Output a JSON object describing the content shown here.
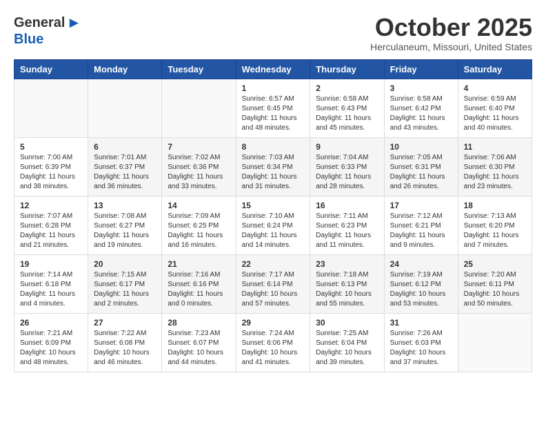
{
  "header": {
    "logo_general": "General",
    "logo_blue": "Blue",
    "month_title": "October 2025",
    "location": "Herculaneum, Missouri, United States"
  },
  "weekdays": [
    "Sunday",
    "Monday",
    "Tuesday",
    "Wednesday",
    "Thursday",
    "Friday",
    "Saturday"
  ],
  "weeks": [
    [
      {
        "day": "",
        "info": ""
      },
      {
        "day": "",
        "info": ""
      },
      {
        "day": "",
        "info": ""
      },
      {
        "day": "1",
        "info": "Sunrise: 6:57 AM\nSunset: 6:45 PM\nDaylight: 11 hours\nand 48 minutes."
      },
      {
        "day": "2",
        "info": "Sunrise: 6:58 AM\nSunset: 6:43 PM\nDaylight: 11 hours\nand 45 minutes."
      },
      {
        "day": "3",
        "info": "Sunrise: 6:58 AM\nSunset: 6:42 PM\nDaylight: 11 hours\nand 43 minutes."
      },
      {
        "day": "4",
        "info": "Sunrise: 6:59 AM\nSunset: 6:40 PM\nDaylight: 11 hours\nand 40 minutes."
      }
    ],
    [
      {
        "day": "5",
        "info": "Sunrise: 7:00 AM\nSunset: 6:39 PM\nDaylight: 11 hours\nand 38 minutes."
      },
      {
        "day": "6",
        "info": "Sunrise: 7:01 AM\nSunset: 6:37 PM\nDaylight: 11 hours\nand 36 minutes."
      },
      {
        "day": "7",
        "info": "Sunrise: 7:02 AM\nSunset: 6:36 PM\nDaylight: 11 hours\nand 33 minutes."
      },
      {
        "day": "8",
        "info": "Sunrise: 7:03 AM\nSunset: 6:34 PM\nDaylight: 11 hours\nand 31 minutes."
      },
      {
        "day": "9",
        "info": "Sunrise: 7:04 AM\nSunset: 6:33 PM\nDaylight: 11 hours\nand 28 minutes."
      },
      {
        "day": "10",
        "info": "Sunrise: 7:05 AM\nSunset: 6:31 PM\nDaylight: 11 hours\nand 26 minutes."
      },
      {
        "day": "11",
        "info": "Sunrise: 7:06 AM\nSunset: 6:30 PM\nDaylight: 11 hours\nand 23 minutes."
      }
    ],
    [
      {
        "day": "12",
        "info": "Sunrise: 7:07 AM\nSunset: 6:28 PM\nDaylight: 11 hours\nand 21 minutes."
      },
      {
        "day": "13",
        "info": "Sunrise: 7:08 AM\nSunset: 6:27 PM\nDaylight: 11 hours\nand 19 minutes."
      },
      {
        "day": "14",
        "info": "Sunrise: 7:09 AM\nSunset: 6:25 PM\nDaylight: 11 hours\nand 16 minutes."
      },
      {
        "day": "15",
        "info": "Sunrise: 7:10 AM\nSunset: 6:24 PM\nDaylight: 11 hours\nand 14 minutes."
      },
      {
        "day": "16",
        "info": "Sunrise: 7:11 AM\nSunset: 6:23 PM\nDaylight: 11 hours\nand 11 minutes."
      },
      {
        "day": "17",
        "info": "Sunrise: 7:12 AM\nSunset: 6:21 PM\nDaylight: 11 hours\nand 9 minutes."
      },
      {
        "day": "18",
        "info": "Sunrise: 7:13 AM\nSunset: 6:20 PM\nDaylight: 11 hours\nand 7 minutes."
      }
    ],
    [
      {
        "day": "19",
        "info": "Sunrise: 7:14 AM\nSunset: 6:18 PM\nDaylight: 11 hours\nand 4 minutes."
      },
      {
        "day": "20",
        "info": "Sunrise: 7:15 AM\nSunset: 6:17 PM\nDaylight: 11 hours\nand 2 minutes."
      },
      {
        "day": "21",
        "info": "Sunrise: 7:16 AM\nSunset: 6:16 PM\nDaylight: 11 hours\nand 0 minutes."
      },
      {
        "day": "22",
        "info": "Sunrise: 7:17 AM\nSunset: 6:14 PM\nDaylight: 10 hours\nand 57 minutes."
      },
      {
        "day": "23",
        "info": "Sunrise: 7:18 AM\nSunset: 6:13 PM\nDaylight: 10 hours\nand 55 minutes."
      },
      {
        "day": "24",
        "info": "Sunrise: 7:19 AM\nSunset: 6:12 PM\nDaylight: 10 hours\nand 53 minutes."
      },
      {
        "day": "25",
        "info": "Sunrise: 7:20 AM\nSunset: 6:11 PM\nDaylight: 10 hours\nand 50 minutes."
      }
    ],
    [
      {
        "day": "26",
        "info": "Sunrise: 7:21 AM\nSunset: 6:09 PM\nDaylight: 10 hours\nand 48 minutes."
      },
      {
        "day": "27",
        "info": "Sunrise: 7:22 AM\nSunset: 6:08 PM\nDaylight: 10 hours\nand 46 minutes."
      },
      {
        "day": "28",
        "info": "Sunrise: 7:23 AM\nSunset: 6:07 PM\nDaylight: 10 hours\nand 44 minutes."
      },
      {
        "day": "29",
        "info": "Sunrise: 7:24 AM\nSunset: 6:06 PM\nDaylight: 10 hours\nand 41 minutes."
      },
      {
        "day": "30",
        "info": "Sunrise: 7:25 AM\nSunset: 6:04 PM\nDaylight: 10 hours\nand 39 minutes."
      },
      {
        "day": "31",
        "info": "Sunrise: 7:26 AM\nSunset: 6:03 PM\nDaylight: 10 hours\nand 37 minutes."
      },
      {
        "day": "",
        "info": ""
      }
    ]
  ]
}
